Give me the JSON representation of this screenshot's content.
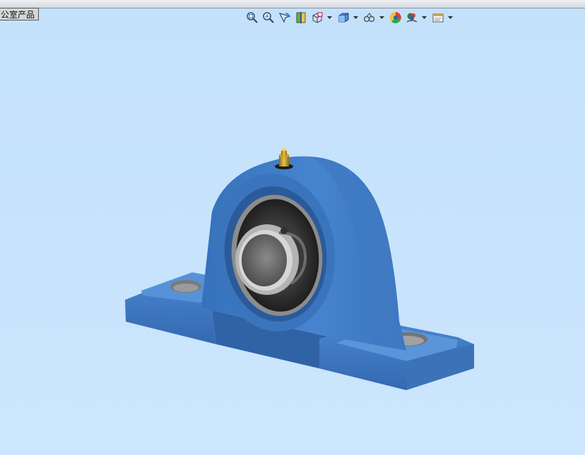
{
  "document": {
    "title_fragment": "公室产品"
  },
  "view_toolbar": {
    "buttons": [
      {
        "name": "zoom-to-fit-icon",
        "dropdown": false
      },
      {
        "name": "zoom-to-area-icon",
        "dropdown": false
      },
      {
        "name": "previous-view-icon",
        "dropdown": false
      },
      {
        "name": "section-view-icon",
        "dropdown": false
      },
      {
        "name": "dynamic-annotation-view-icon",
        "dropdown": true
      },
      {
        "name": "view-orientation-icon",
        "dropdown": true
      },
      {
        "name": "display-style-icon",
        "dropdown": true
      },
      {
        "name": "hide-show-items-icon",
        "dropdown": true
      },
      {
        "name": "edit-appearance-icon",
        "dropdown": false
      },
      {
        "name": "apply-scene-icon",
        "dropdown": true
      },
      {
        "name": "view-settings-icon",
        "dropdown": true
      }
    ]
  },
  "viewport": {
    "model": "pillow-block-bearing",
    "colors": {
      "background": "#c6e2fc",
      "housing": "#3f7cc6",
      "housing_shadow": "#2c5f9f",
      "insert_dark": "#2e2e2e",
      "inner_ring": "#a9a9a9",
      "grease_fitting": "#c8a22a"
    }
  }
}
